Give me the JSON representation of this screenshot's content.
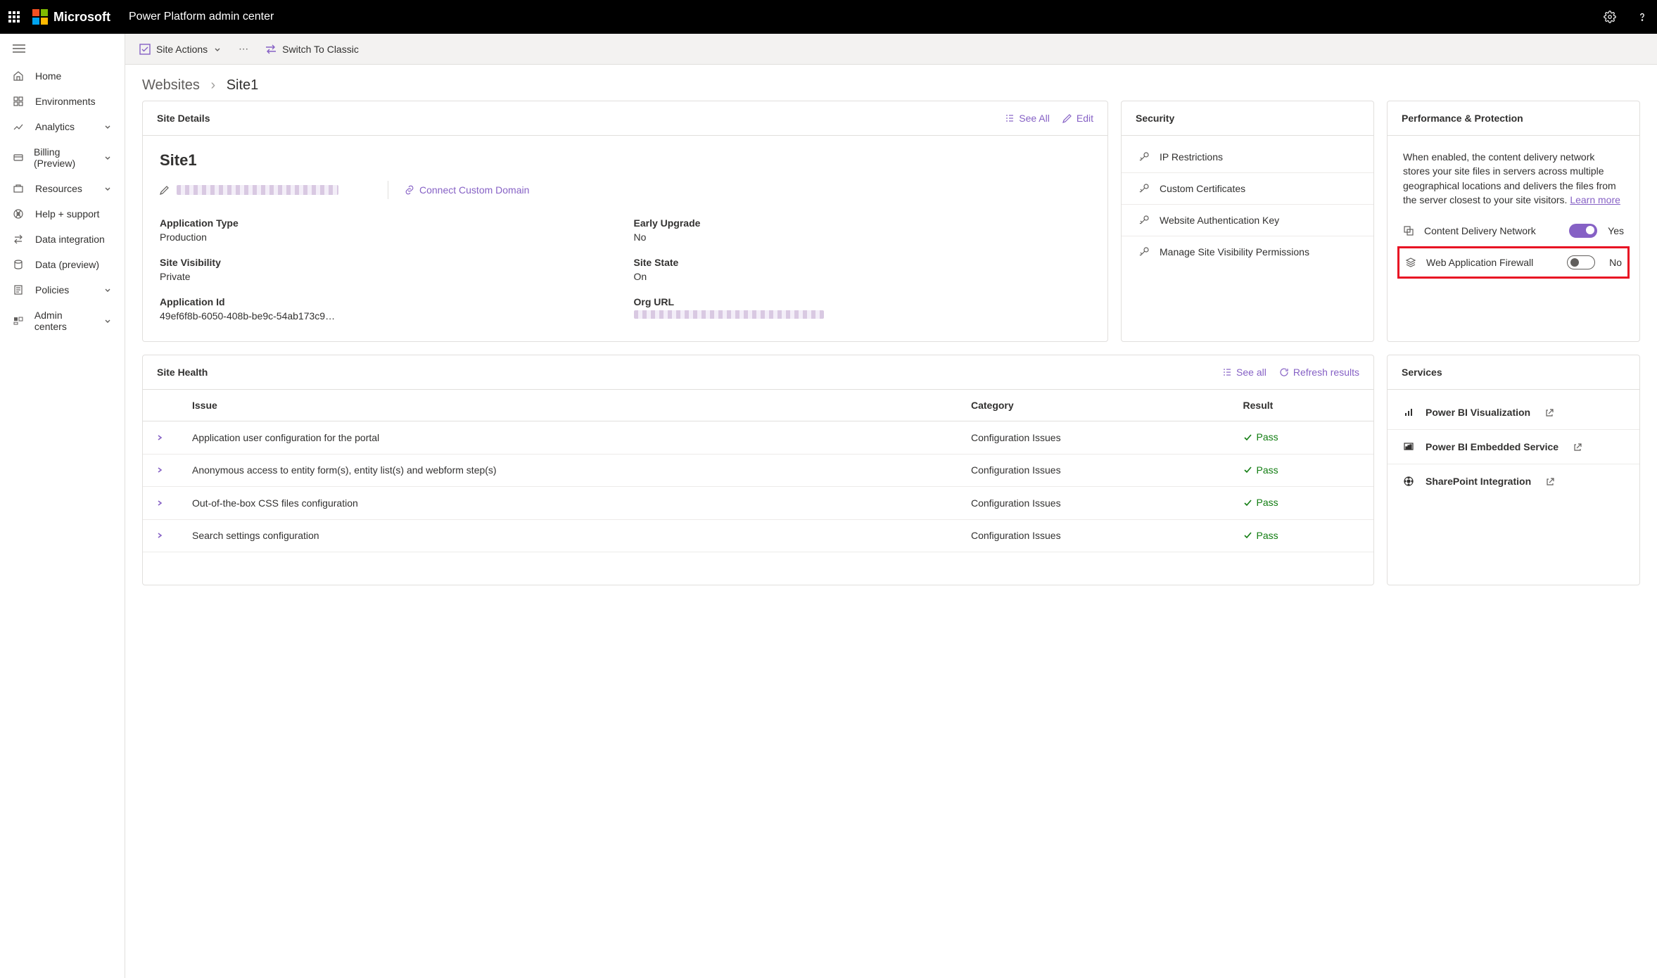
{
  "header": {
    "brand": "Microsoft",
    "app_title": "Power Platform admin center"
  },
  "sidebar": {
    "items": [
      {
        "label": "Home",
        "icon": "home"
      },
      {
        "label": "Environments",
        "icon": "environments"
      },
      {
        "label": "Analytics",
        "icon": "analytics",
        "expandable": true
      },
      {
        "label": "Billing (Preview)",
        "icon": "billing",
        "expandable": true
      },
      {
        "label": "Resources",
        "icon": "resources",
        "expandable": true
      },
      {
        "label": "Help + support",
        "icon": "help"
      },
      {
        "label": "Data integration",
        "icon": "dataint"
      },
      {
        "label": "Data (preview)",
        "icon": "datapreview"
      },
      {
        "label": "Policies",
        "icon": "policies",
        "expandable": true
      },
      {
        "label": "Admin centers",
        "icon": "admincenters",
        "expandable": true
      }
    ]
  },
  "cmdbar": {
    "site_actions": "Site Actions",
    "switch_classic": "Switch To Classic"
  },
  "breadcrumb": {
    "root": "Websites",
    "current": "Site1"
  },
  "site_details": {
    "card_title": "Site Details",
    "see_all": "See All",
    "edit": "Edit",
    "site_name": "Site1",
    "connect_domain": "Connect Custom Domain",
    "fields": {
      "app_type": {
        "label": "Application Type",
        "value": "Production"
      },
      "early_upgrade": {
        "label": "Early Upgrade",
        "value": "No"
      },
      "visibility": {
        "label": "Site Visibility",
        "value": "Private"
      },
      "site_state": {
        "label": "Site State",
        "value": "On"
      },
      "app_id": {
        "label": "Application Id",
        "value": "49ef6f8b-6050-408b-be9c-54ab173c9…"
      },
      "org_url": {
        "label": "Org URL",
        "value": ""
      }
    }
  },
  "security": {
    "card_title": "Security",
    "items": [
      {
        "label": "IP Restrictions"
      },
      {
        "label": "Custom Certificates"
      },
      {
        "label": "Website Authentication Key"
      },
      {
        "label": "Manage Site Visibility Permissions"
      }
    ]
  },
  "performance": {
    "card_title": "Performance & Protection",
    "description": "When enabled, the content delivery network stores your site files in servers across multiple geographical locations and delivers the files from the server closest to your site visitors. ",
    "learn_more": "Learn more",
    "toggles": [
      {
        "label": "Content Delivery Network",
        "state": "Yes",
        "on": true
      },
      {
        "label": "Web Application Firewall",
        "state": "No",
        "on": false,
        "highlight": true
      }
    ]
  },
  "site_health": {
    "card_title": "Site Health",
    "see_all": "See all",
    "refresh": "Refresh results",
    "columns": {
      "issue": "Issue",
      "category": "Category",
      "result": "Result"
    },
    "rows": [
      {
        "issue": "Application user configuration for the portal",
        "category": "Configuration Issues",
        "result": "Pass"
      },
      {
        "issue": "Anonymous access to entity form(s), entity list(s) and webform step(s)",
        "category": "Configuration Issues",
        "result": "Pass"
      },
      {
        "issue": "Out-of-the-box CSS files configuration",
        "category": "Configuration Issues",
        "result": "Pass"
      },
      {
        "issue": "Search settings configuration",
        "category": "Configuration Issues",
        "result": "Pass"
      }
    ]
  },
  "services": {
    "card_title": "Services",
    "items": [
      {
        "label": "Power BI Visualization"
      },
      {
        "label": "Power BI Embedded Service"
      },
      {
        "label": "SharePoint Integration"
      }
    ]
  }
}
